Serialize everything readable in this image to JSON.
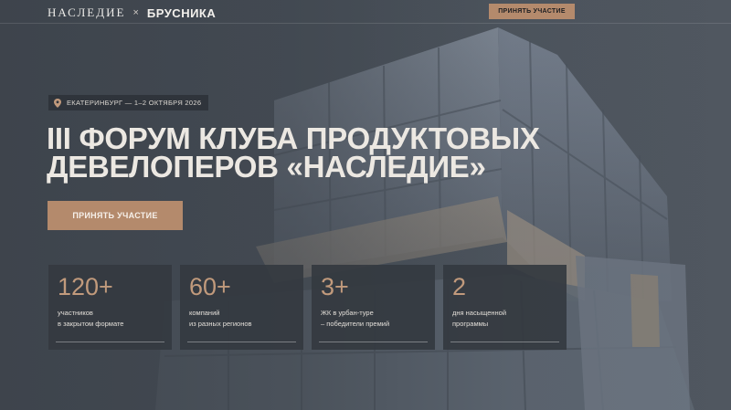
{
  "header": {
    "logo_left": "НАСЛЕДИЕ",
    "logo_separator": "×",
    "logo_right": "БРУСНИКА",
    "cta_label": "ПРИНЯТЬ УЧАСТИЕ"
  },
  "event": {
    "location_date": "ЕКАТЕРИНБУРГ — 1–2 ОКТЯБРЯ 2026",
    "title_line1": "III ФОРУМ КЛУБА ПРОДУКТОВЫХ",
    "title_line2": "ДЕВЕЛОПЕРОВ «НАСЛЕДИЕ»",
    "cta_label": "ПРИНЯТЬ УЧАСТИЕ"
  },
  "stats": [
    {
      "number": "120+",
      "line1": "участников",
      "line2": "в закрытом формате"
    },
    {
      "number": "60+",
      "line1": "компаний",
      "line2": "из разных регионов"
    },
    {
      "number": "3+",
      "line1": "ЖК в урбан-туре",
      "line2": "– победители премий"
    },
    {
      "number": "2",
      "line1": "дня насыщенной",
      "line2": "программы"
    }
  ],
  "colors": {
    "accent": "#b48a6c",
    "background": "#4a5058",
    "card": "#343940"
  },
  "icons": {
    "location": "map-pin-icon"
  }
}
